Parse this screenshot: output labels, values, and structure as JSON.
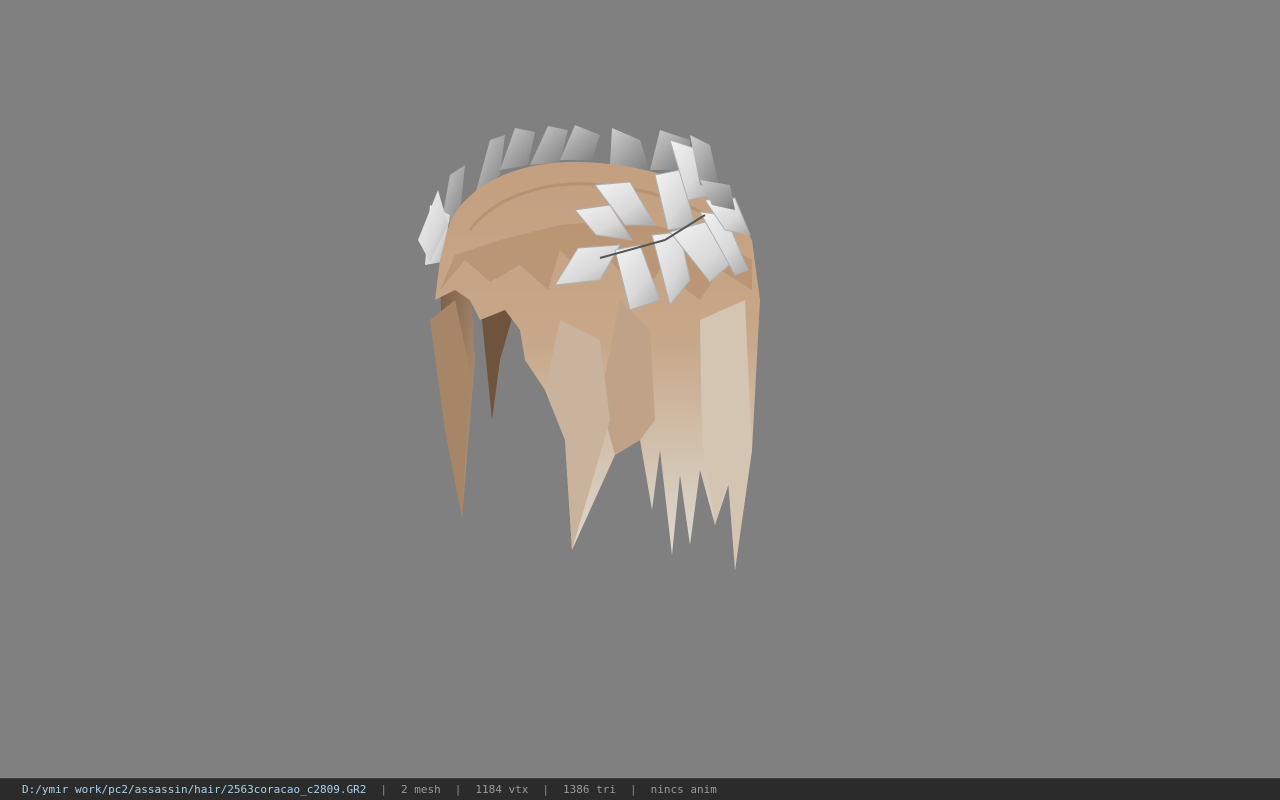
{
  "viewport": {
    "background_color": "#808080",
    "model": "hair-with-silver-laurel-crown"
  },
  "statusbar": {
    "file_path": "D:/ymir work/pc2/assassin/hair/2563coracao_c2809.GR2",
    "separator": "|",
    "mesh_count": "2 mesh",
    "vertex_count": "1184 vtx",
    "triangle_count": "1386 tri",
    "animation": "nincs anim"
  },
  "colors": {
    "hair": "#c9a888",
    "hair_dark": "#7d5f45",
    "hair_tip": "#d8d0c4",
    "leaf": "#e6e6e6",
    "leaf_shade": "#9c9c9c",
    "statusbar_bg": "#2b2b2b",
    "path_text": "#a9cfe8"
  }
}
